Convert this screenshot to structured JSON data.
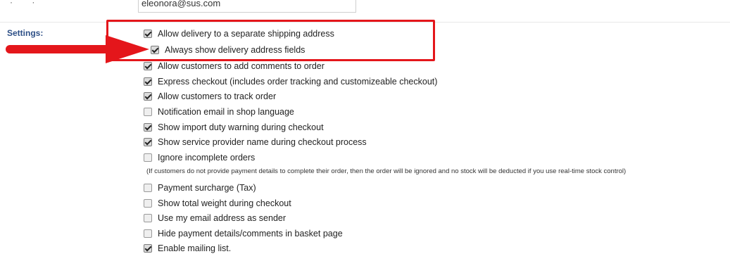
{
  "top": {
    "left_text": "·   ·",
    "email_value": "eleonora@sus.com"
  },
  "settings_label": "Settings:",
  "options": [
    {
      "label": "Allow delivery to a separate shipping address",
      "checked": true
    },
    {
      "label": "Always show delivery address fields",
      "checked": true
    },
    {
      "label": "Allow customers to add comments to order",
      "checked": true
    },
    {
      "label": "Express checkout (includes order tracking and customizeable checkout)",
      "checked": true
    },
    {
      "label": "Allow customers to track order",
      "checked": true
    },
    {
      "label": "Notification email in shop language",
      "checked": false
    },
    {
      "label": "Show import duty warning during checkout",
      "checked": true
    },
    {
      "label": "Show service provider name during checkout process",
      "checked": true
    },
    {
      "label": "Ignore incomplete orders",
      "checked": false
    },
    {
      "label": "Payment surcharge (Tax)",
      "checked": false
    },
    {
      "label": "Show total weight during checkout",
      "checked": false
    },
    {
      "label": "Use my email address as sender",
      "checked": false
    },
    {
      "label": "Hide payment details/comments in basket page",
      "checked": false
    },
    {
      "label": "Enable mailing list.",
      "checked": true
    }
  ],
  "ignore_note": "(If customers do not provide payment details to complete their order, then the order will be ignored and no stock will be deducted if you use real-time stock control)",
  "colors": {
    "annotation_red": "#e4161b",
    "settings_label": "#2d4f86"
  }
}
